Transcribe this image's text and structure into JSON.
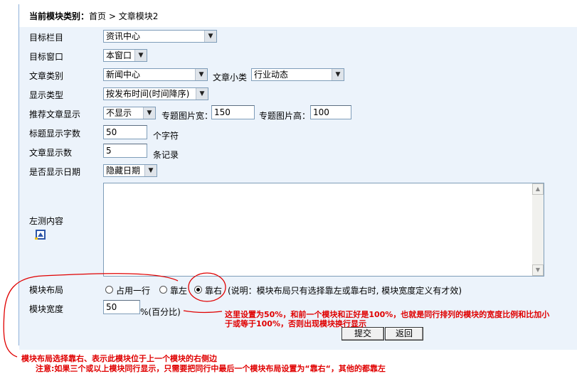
{
  "breadcrumb": {
    "label": "当前模块类别：",
    "home": "首页",
    "sep": ">",
    "current": "文章模块2"
  },
  "fields": {
    "target_column": {
      "label": "目标栏目",
      "value": "资讯中心"
    },
    "target_window": {
      "label": "目标窗口",
      "value": "本窗口"
    },
    "article_category": {
      "label": "文章类别",
      "value": "新闻中心",
      "sub_label": "文章小类",
      "sub_value": "行业动态"
    },
    "display_type": {
      "label": "显示类型",
      "value": "按发布时间(时间降序)"
    },
    "recommend": {
      "label": "推荐文章显示",
      "value": "不显示",
      "img_w_label": "专题图片宽：",
      "img_w": "150",
      "img_h_label": "专题图片高：",
      "img_h": "100"
    },
    "title_chars": {
      "label": "标题显示字数",
      "value": "50",
      "unit": "个字符"
    },
    "article_count": {
      "label": "文章显示数",
      "value": "5",
      "unit": "条记录"
    },
    "show_date": {
      "label": "是否显示日期",
      "value": "隐藏日期"
    },
    "left_content": {
      "label": "左测内容"
    },
    "layout": {
      "label": "模块布局",
      "options": [
        "占用一行",
        "靠左",
        "靠右"
      ],
      "selected": "靠右",
      "note": "(说明：模块布局只有选择靠左或靠右时, 模块宽度定义有才效)"
    },
    "width": {
      "label": "模块宽度",
      "value": "50",
      "unit": "%(百分比)"
    }
  },
  "buttons": {
    "submit": "提交",
    "back": "返回"
  },
  "annotations": {
    "width_note_1": "这里设置为50%，和前一个模块和正好是100%，也就是同行排列的模块的宽度比例和比加小",
    "width_note_2": "于或等于100%，否则出现模块换行显示",
    "layout_note": "模块布局选择靠右、表示此模块位于上一个模块的右侧边",
    "note": "注意:如果三个或以上模块同行显示，只需要把同行中最后一个模块布局设置为“靠右“，其他的都靠左"
  },
  "colors": {
    "panel_bg": "#ecf3fb",
    "annotation": "#e00000"
  }
}
